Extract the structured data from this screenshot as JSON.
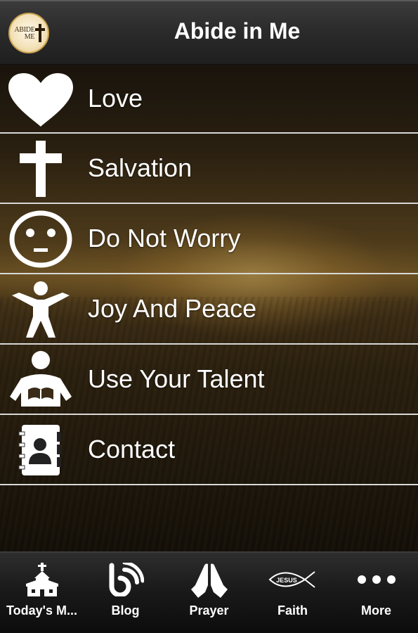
{
  "header": {
    "title": "Abide in Me",
    "logo_text_top": "ABIDE",
    "logo_text_bottom": "ME",
    "logo_icon": "cross-icon"
  },
  "menu": {
    "items": [
      {
        "label": "Love",
        "icon": "heart-icon"
      },
      {
        "label": "Salvation",
        "icon": "cross-icon"
      },
      {
        "label": "Do Not Worry",
        "icon": "face-icon"
      },
      {
        "label": "Joy And Peace",
        "icon": "person-raised-arms-icon"
      },
      {
        "label": "Use Your Talent",
        "icon": "person-reading-icon"
      },
      {
        "label": "Contact",
        "icon": "address-book-icon"
      }
    ]
  },
  "tabbar": {
    "tabs": [
      {
        "label": "Today's M...",
        "icon": "church-icon"
      },
      {
        "label": "Blog",
        "icon": "blog-icon"
      },
      {
        "label": "Prayer",
        "icon": "praying-hands-icon"
      },
      {
        "label": "Faith",
        "icon": "jesus-fish-icon",
        "icon_text": "JESUS"
      },
      {
        "label": "More",
        "icon": "more-dots-icon"
      }
    ]
  },
  "colors": {
    "text": "#ffffff",
    "separator": "#d8d8d8",
    "header_bg": "#2a2a2a",
    "tabbar_bg": "#1a1a1a"
  }
}
